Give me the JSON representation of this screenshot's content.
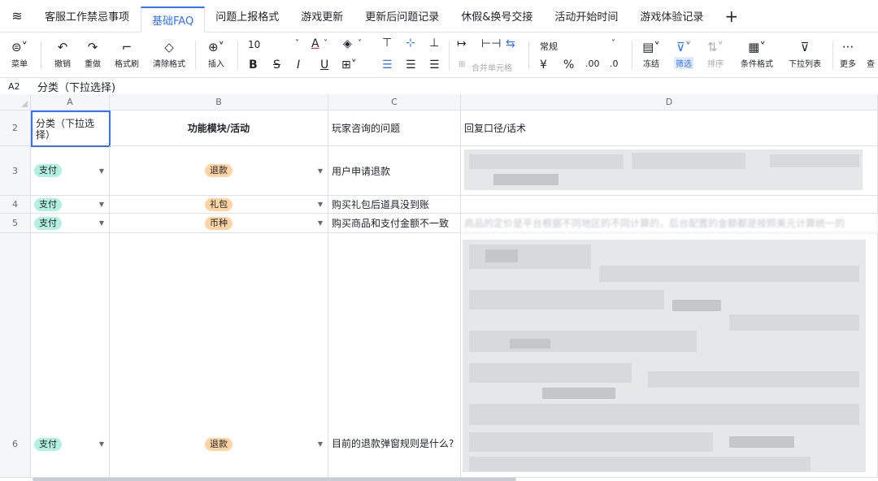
{
  "tabs": [
    {
      "label": "客服工作禁忌事项",
      "active": false
    },
    {
      "label": "基础FAQ",
      "active": true
    },
    {
      "label": "问题上报格式",
      "active": false
    },
    {
      "label": "游戏更新",
      "active": false
    },
    {
      "label": "更新后问题记录",
      "active": false
    },
    {
      "label": "休假&换号交接",
      "active": false
    },
    {
      "label": "活动开始时间",
      "active": false
    },
    {
      "label": "游戏体验记录",
      "active": false
    }
  ],
  "toolbar": {
    "menu": "菜单",
    "undo": "撤销",
    "redo": "重做",
    "format_painter": "格式刷",
    "clear_format": "清除格式",
    "insert": "插入",
    "font_size": "10",
    "merge_cells": "合并单元格",
    "number_format": "常规",
    "freeze": "冻结",
    "filter": "筛选",
    "sort": "排序",
    "conditional_format": "条件格式",
    "dropdown_list": "下拉列表",
    "more": "更多",
    "find": "查"
  },
  "formula_bar": {
    "cell_ref": "A2",
    "value": "分类（下拉选择)"
  },
  "columns": [
    "A",
    "B",
    "C",
    "D"
  ],
  "rows": [
    {
      "num": "2",
      "a": "分类（下拉选择）",
      "b": "功能模块/活动",
      "c": "玩家咨询的问题",
      "d": "回复口径/话术"
    },
    {
      "num": "3",
      "a": "支付",
      "b": "退款",
      "c": "用户申请退款",
      "d": ""
    },
    {
      "num": "4",
      "a": "支付",
      "b": "礼包",
      "c": "购买礼包后道具没到账",
      "d": ""
    },
    {
      "num": "5",
      "a": "支付",
      "b": "币种",
      "c": "购买商品和支付金额不一致",
      "d": "商品的定价是平台根据不同地区的不同计算的，后台配置的金额都是按照美元计算统一的"
    },
    {
      "num": "6",
      "a": "支付",
      "b": "退款",
      "c": "目前的退款弹窗规则是什么?",
      "d": ""
    }
  ],
  "colors": {
    "accent": "#3370ff",
    "chip_teal": "#b3f0e0",
    "chip_orange": "#fed4a4"
  }
}
